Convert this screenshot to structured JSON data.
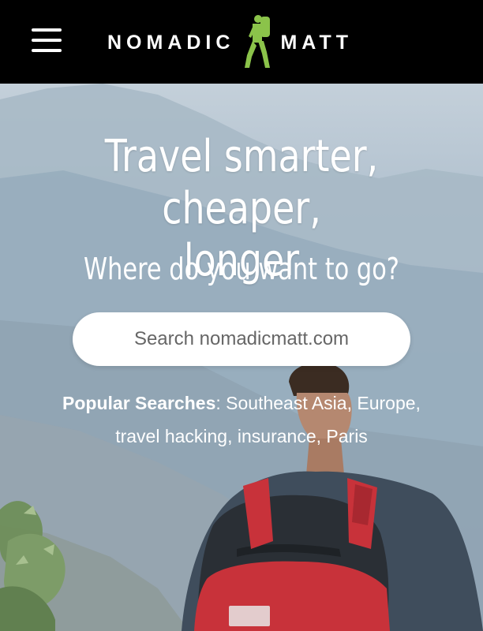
{
  "header": {
    "logo_left": "NOMADIC",
    "logo_right": "MATT",
    "menu_icon": "hamburger-menu-icon"
  },
  "hero": {
    "headline_line1": "Travel smarter, cheaper,",
    "headline_line2": "longer",
    "subhead": "Where do you want to go?",
    "search_placeholder": "Search nomadicmatt.com",
    "popular_label": "Popular Searches",
    "popular_separator": ": ",
    "popular_links": [
      {
        "text": "Southeast Asia",
        "sep": ", "
      },
      {
        "text": "Europe",
        "sep": ","
      },
      {
        "text": "travel hacking",
        "sep": ", "
      },
      {
        "text": "insurance",
        "sep": ", "
      },
      {
        "text": "Paris",
        "sep": ""
      }
    ]
  },
  "colors": {
    "header_bg": "#000000",
    "logo_accent": "#8bc34a",
    "backpack_red": "#c8323a"
  }
}
